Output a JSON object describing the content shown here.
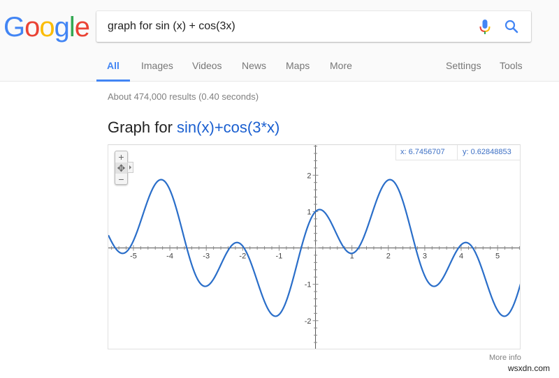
{
  "logo": {
    "letters": [
      "G",
      "o",
      "o",
      "g",
      "l",
      "e"
    ],
    "colors": [
      "#4285f4",
      "#ea4335",
      "#fbbc05",
      "#4285f4",
      "#34a853",
      "#ea4335"
    ]
  },
  "search": {
    "value": "graph for sin (x) + cos(3x)",
    "mic_icon": "microphone-icon",
    "search_icon": "magnifier-icon"
  },
  "tabs": [
    {
      "label": "All",
      "active": true
    },
    {
      "label": "Images",
      "active": false
    },
    {
      "label": "Videos",
      "active": false
    },
    {
      "label": "News",
      "active": false
    },
    {
      "label": "Maps",
      "active": false
    },
    {
      "label": "More",
      "active": false
    },
    {
      "label": "Settings",
      "active": false
    },
    {
      "label": "Tools",
      "active": false
    }
  ],
  "result_stats": "About 474,000 results (0.40 seconds)",
  "graph": {
    "title_prefix": "Graph for ",
    "function": "sin(x)+cos(3*x)",
    "zoom_in": "+",
    "zoom_out": "−",
    "pan": "✥",
    "readout_x": "x: 6.7456707",
    "readout_y": "y: 0.62848853",
    "more_info": "More info",
    "curve_color": "#2a6ec9"
  },
  "chart_data": {
    "type": "line",
    "function": "sin(x)+cos(3*x)",
    "xlim": [
      -5.69,
      5.65
    ],
    "ylim": [
      -2.81,
      2.83
    ],
    "x_ticks": [
      -5,
      -4,
      -3,
      -2,
      -1,
      1,
      2,
      3,
      4,
      5
    ],
    "y_ticks": [
      -2,
      -1,
      1,
      2
    ],
    "minor_tick_step": 0.2,
    "grid": false
  },
  "watermark": "wsxdn.com"
}
